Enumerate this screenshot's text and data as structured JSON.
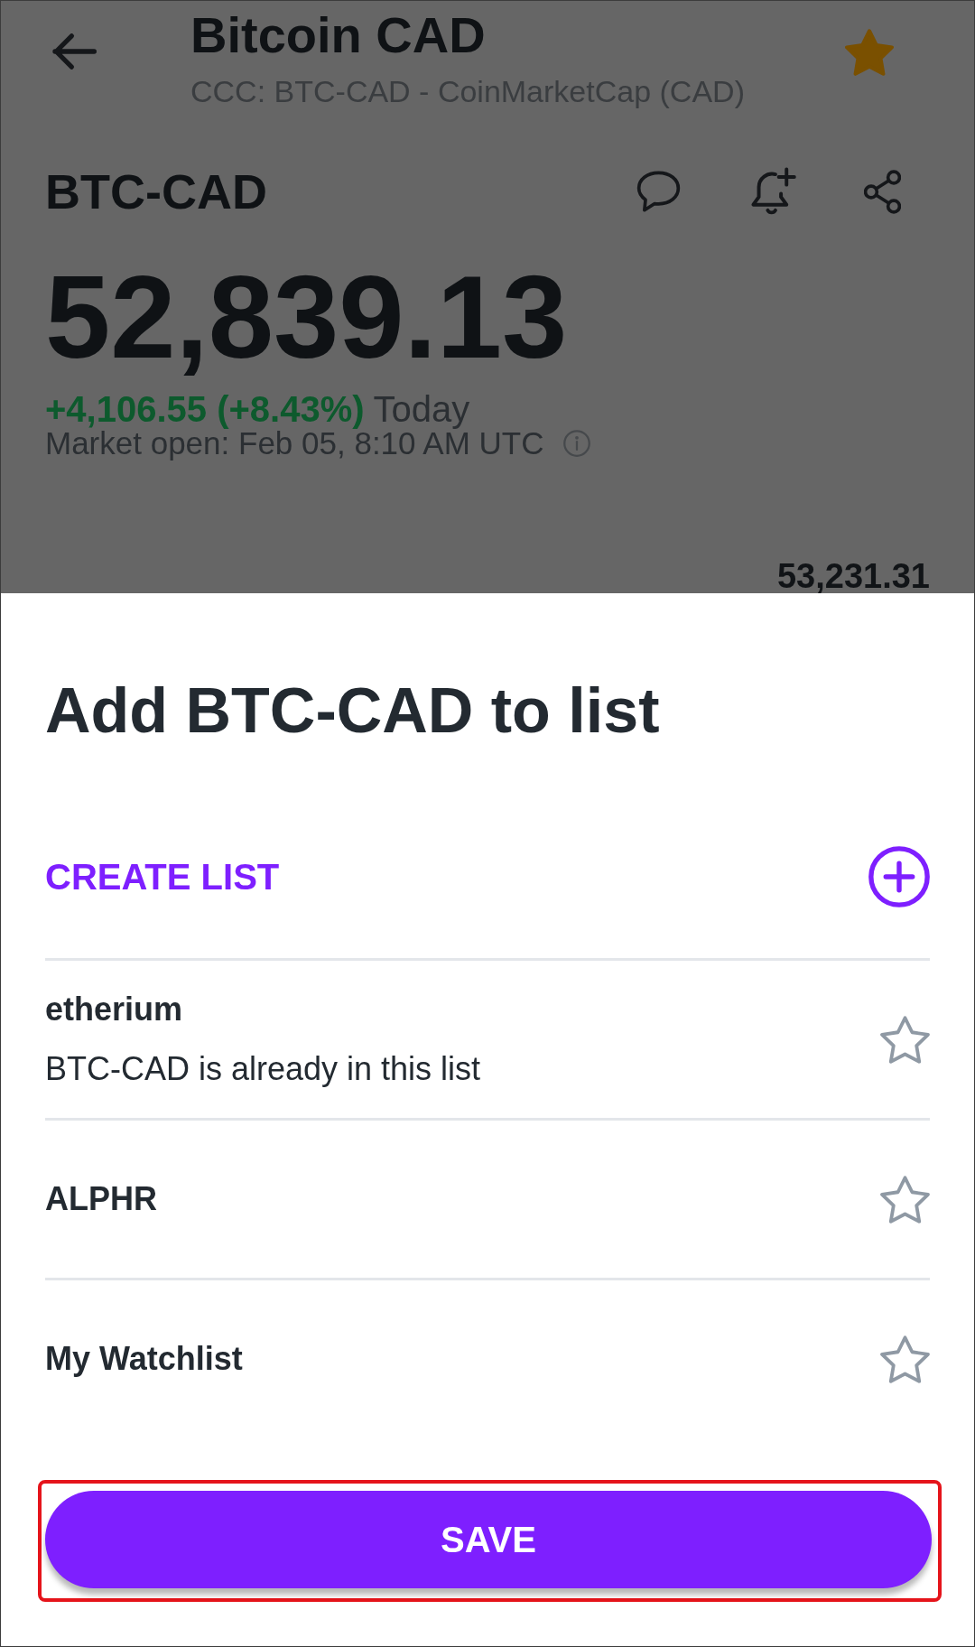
{
  "header": {
    "title": "Bitcoin CAD",
    "subtitle": "CCC: BTC-CAD - CoinMarketCap (CAD)",
    "favorite": true
  },
  "quote": {
    "symbol": "BTC-CAD",
    "price": "52,839.13",
    "change": "+4,106.55 (+8.43%)",
    "change_period": "Today",
    "market_status": "Market open: Feb 05, 8:10 AM UTC",
    "chart_high": "53,231.31"
  },
  "sheet": {
    "title": "Add BTC-CAD to list",
    "create_label": "CREATE LIST",
    "lists": [
      {
        "name": "etherium",
        "note": "BTC-CAD is already in this list",
        "starred": false
      },
      {
        "name": "ALPHR",
        "starred": false
      },
      {
        "name": "My Watchlist",
        "starred": false
      }
    ],
    "save_button": {
      "label": "SAVE",
      "highlighted": true
    }
  }
}
